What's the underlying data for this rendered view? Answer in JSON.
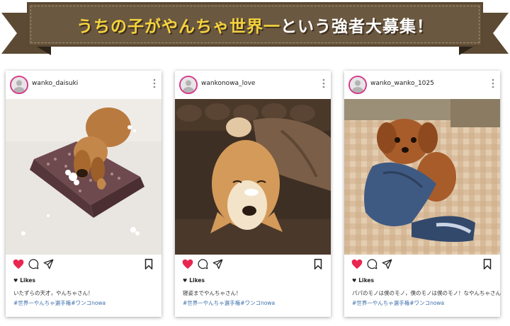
{
  "banner": {
    "title_part1": "うちの子がやんちゃ世界一",
    "title_part2": "という強者大募集！"
  },
  "colors": {
    "banner_bg": "#6b5840",
    "title_highlight": "#f4d33e",
    "like_heart": "#e8264f",
    "avatar_ring": "#d6398a",
    "hashtag": "#3a6ea8"
  },
  "posts": [
    {
      "username": "wanko_daisuki",
      "likes_label": "Likes",
      "caption": "いたずらの天才，やんちゃさん！",
      "hashtags": "#世界一やんちゃ選手権#ワンコnowa",
      "photo_alt": "dachshund-tearing-cushion"
    },
    {
      "username": "wankonowa_love",
      "likes_label": "Likes",
      "caption": "寝姿までやんちゃさん！",
      "hashtags": "#世界一やんちゃ選手権#ワンコnowa",
      "photo_alt": "shiba-sleeping-upside-down"
    },
    {
      "username": "wanko_wanko_1025",
      "likes_label": "Likes",
      "caption": "パパのモノは僕のモノ，僕のモノは僕のモノ！なやんちゃさん",
      "hashtags": "#世界一やんちゃ選手権#ワンコnowa",
      "photo_alt": "poodle-biting-slipper"
    }
  ],
  "icons": {
    "heart": "heart-icon",
    "comment": "comment-icon",
    "share": "send-icon",
    "save": "bookmark-icon",
    "more": "more-vertical-icon"
  }
}
